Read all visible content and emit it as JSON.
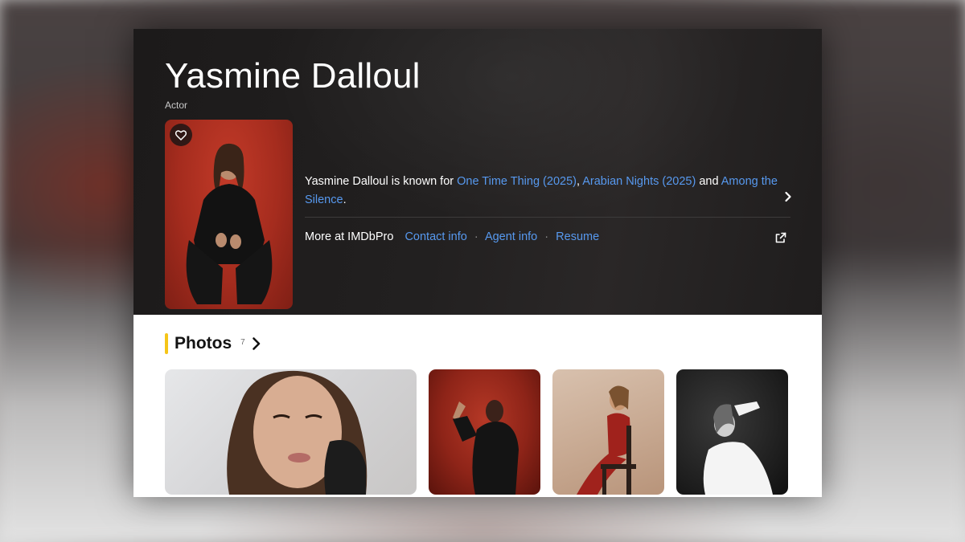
{
  "person": {
    "name": "Yasmine Dalloul",
    "role": "Actor"
  },
  "bio": {
    "prefix": "Yasmine Dalloul is known for",
    "known_for": [
      "One Time Thing (2025)",
      "Arabian Nights (2025)",
      "Among the Silence"
    ],
    "comma": ",",
    "and": "and",
    "period": "."
  },
  "imdbpro": {
    "label": "More at IMDbPro",
    "links": [
      "Contact info",
      "Agent info",
      "Resume"
    ],
    "separator": "·"
  },
  "photos": {
    "title": "Photos",
    "count": "7"
  },
  "icons": {
    "watchlist": "heart-icon",
    "bio_more": "chevron-right-icon",
    "imdbpro_external": "external-link-icon",
    "photos_more": "chevron-right-icon"
  },
  "colors": {
    "accent": "#f5c518",
    "link": "#5799ef",
    "hero_bg": "#1f1d1d"
  }
}
